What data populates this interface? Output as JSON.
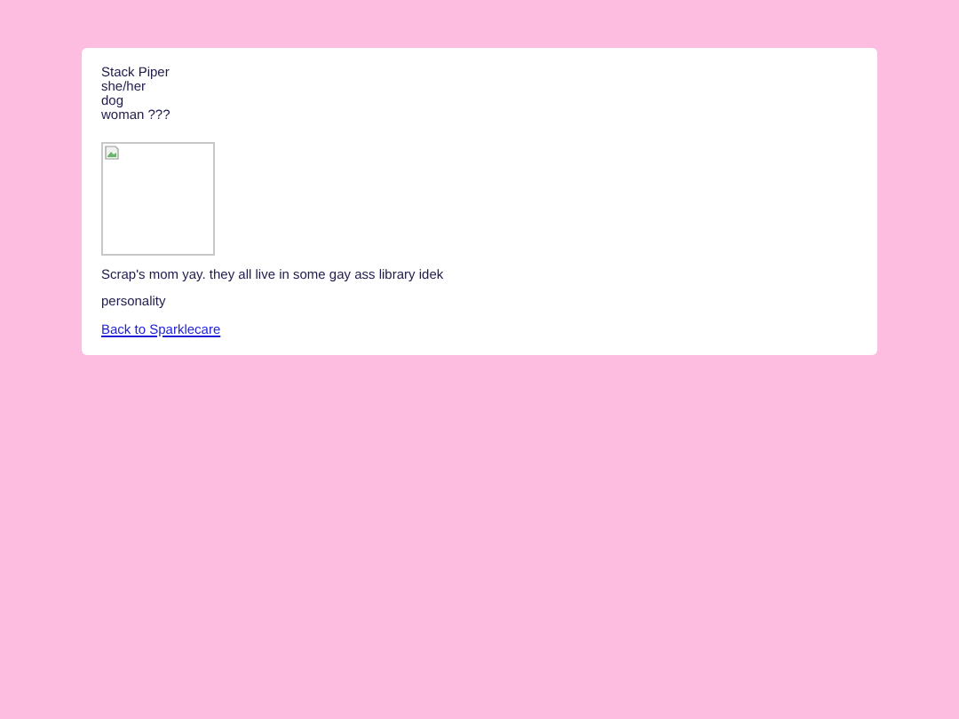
{
  "profile_lines": [
    "Stack Piper",
    "she/her",
    "dog",
    "woman ???"
  ],
  "image": {
    "kind": "broken"
  },
  "paragraphs": [
    "Scrap's mom yay. they all live in some gay ass library idek",
    "personality"
  ],
  "link": "Back to Sparklecare"
}
